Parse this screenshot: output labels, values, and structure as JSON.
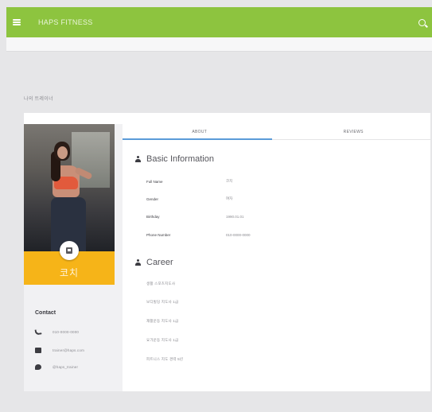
{
  "topbar": {
    "title": "HAPS FITNESS",
    "icons": [
      "menu-icon",
      "search-icon"
    ]
  },
  "page": {
    "section_label": "나의 트레이너"
  },
  "profile": {
    "name": "코치",
    "contact_title": "Contact",
    "contacts": [
      {
        "icon": "phone-icon",
        "text": "010-0000-0000"
      },
      {
        "icon": "mail-icon",
        "text": "trainer@haps.com"
      },
      {
        "icon": "twitter-icon",
        "text": "@haps_trainer"
      }
    ]
  },
  "tabs": [
    {
      "label": "ABOUT",
      "active": true
    },
    {
      "label": "REVIEWS",
      "active": false
    }
  ],
  "basic_info": {
    "title": "Basic Information",
    "rows": [
      {
        "label": "Full Name",
        "value": "코치"
      },
      {
        "label": "Gender",
        "value": "여자"
      },
      {
        "label": "Birthday",
        "value": "1990.01.01"
      },
      {
        "label": "Phone Number",
        "value": "010-0000-0000"
      }
    ]
  },
  "career": {
    "title": "Career",
    "items": [
      "생활 스포츠지도사",
      "보디빌딩 지도사 1급",
      "재활운동 지도사 1급",
      "요가운동 지도사 1급",
      "피트니스 지도 경력 5년"
    ]
  },
  "colors": {
    "topbar": "#8dc43f",
    "name_panel": "#f6b418",
    "tab_indicator": "#5b9bd8"
  }
}
